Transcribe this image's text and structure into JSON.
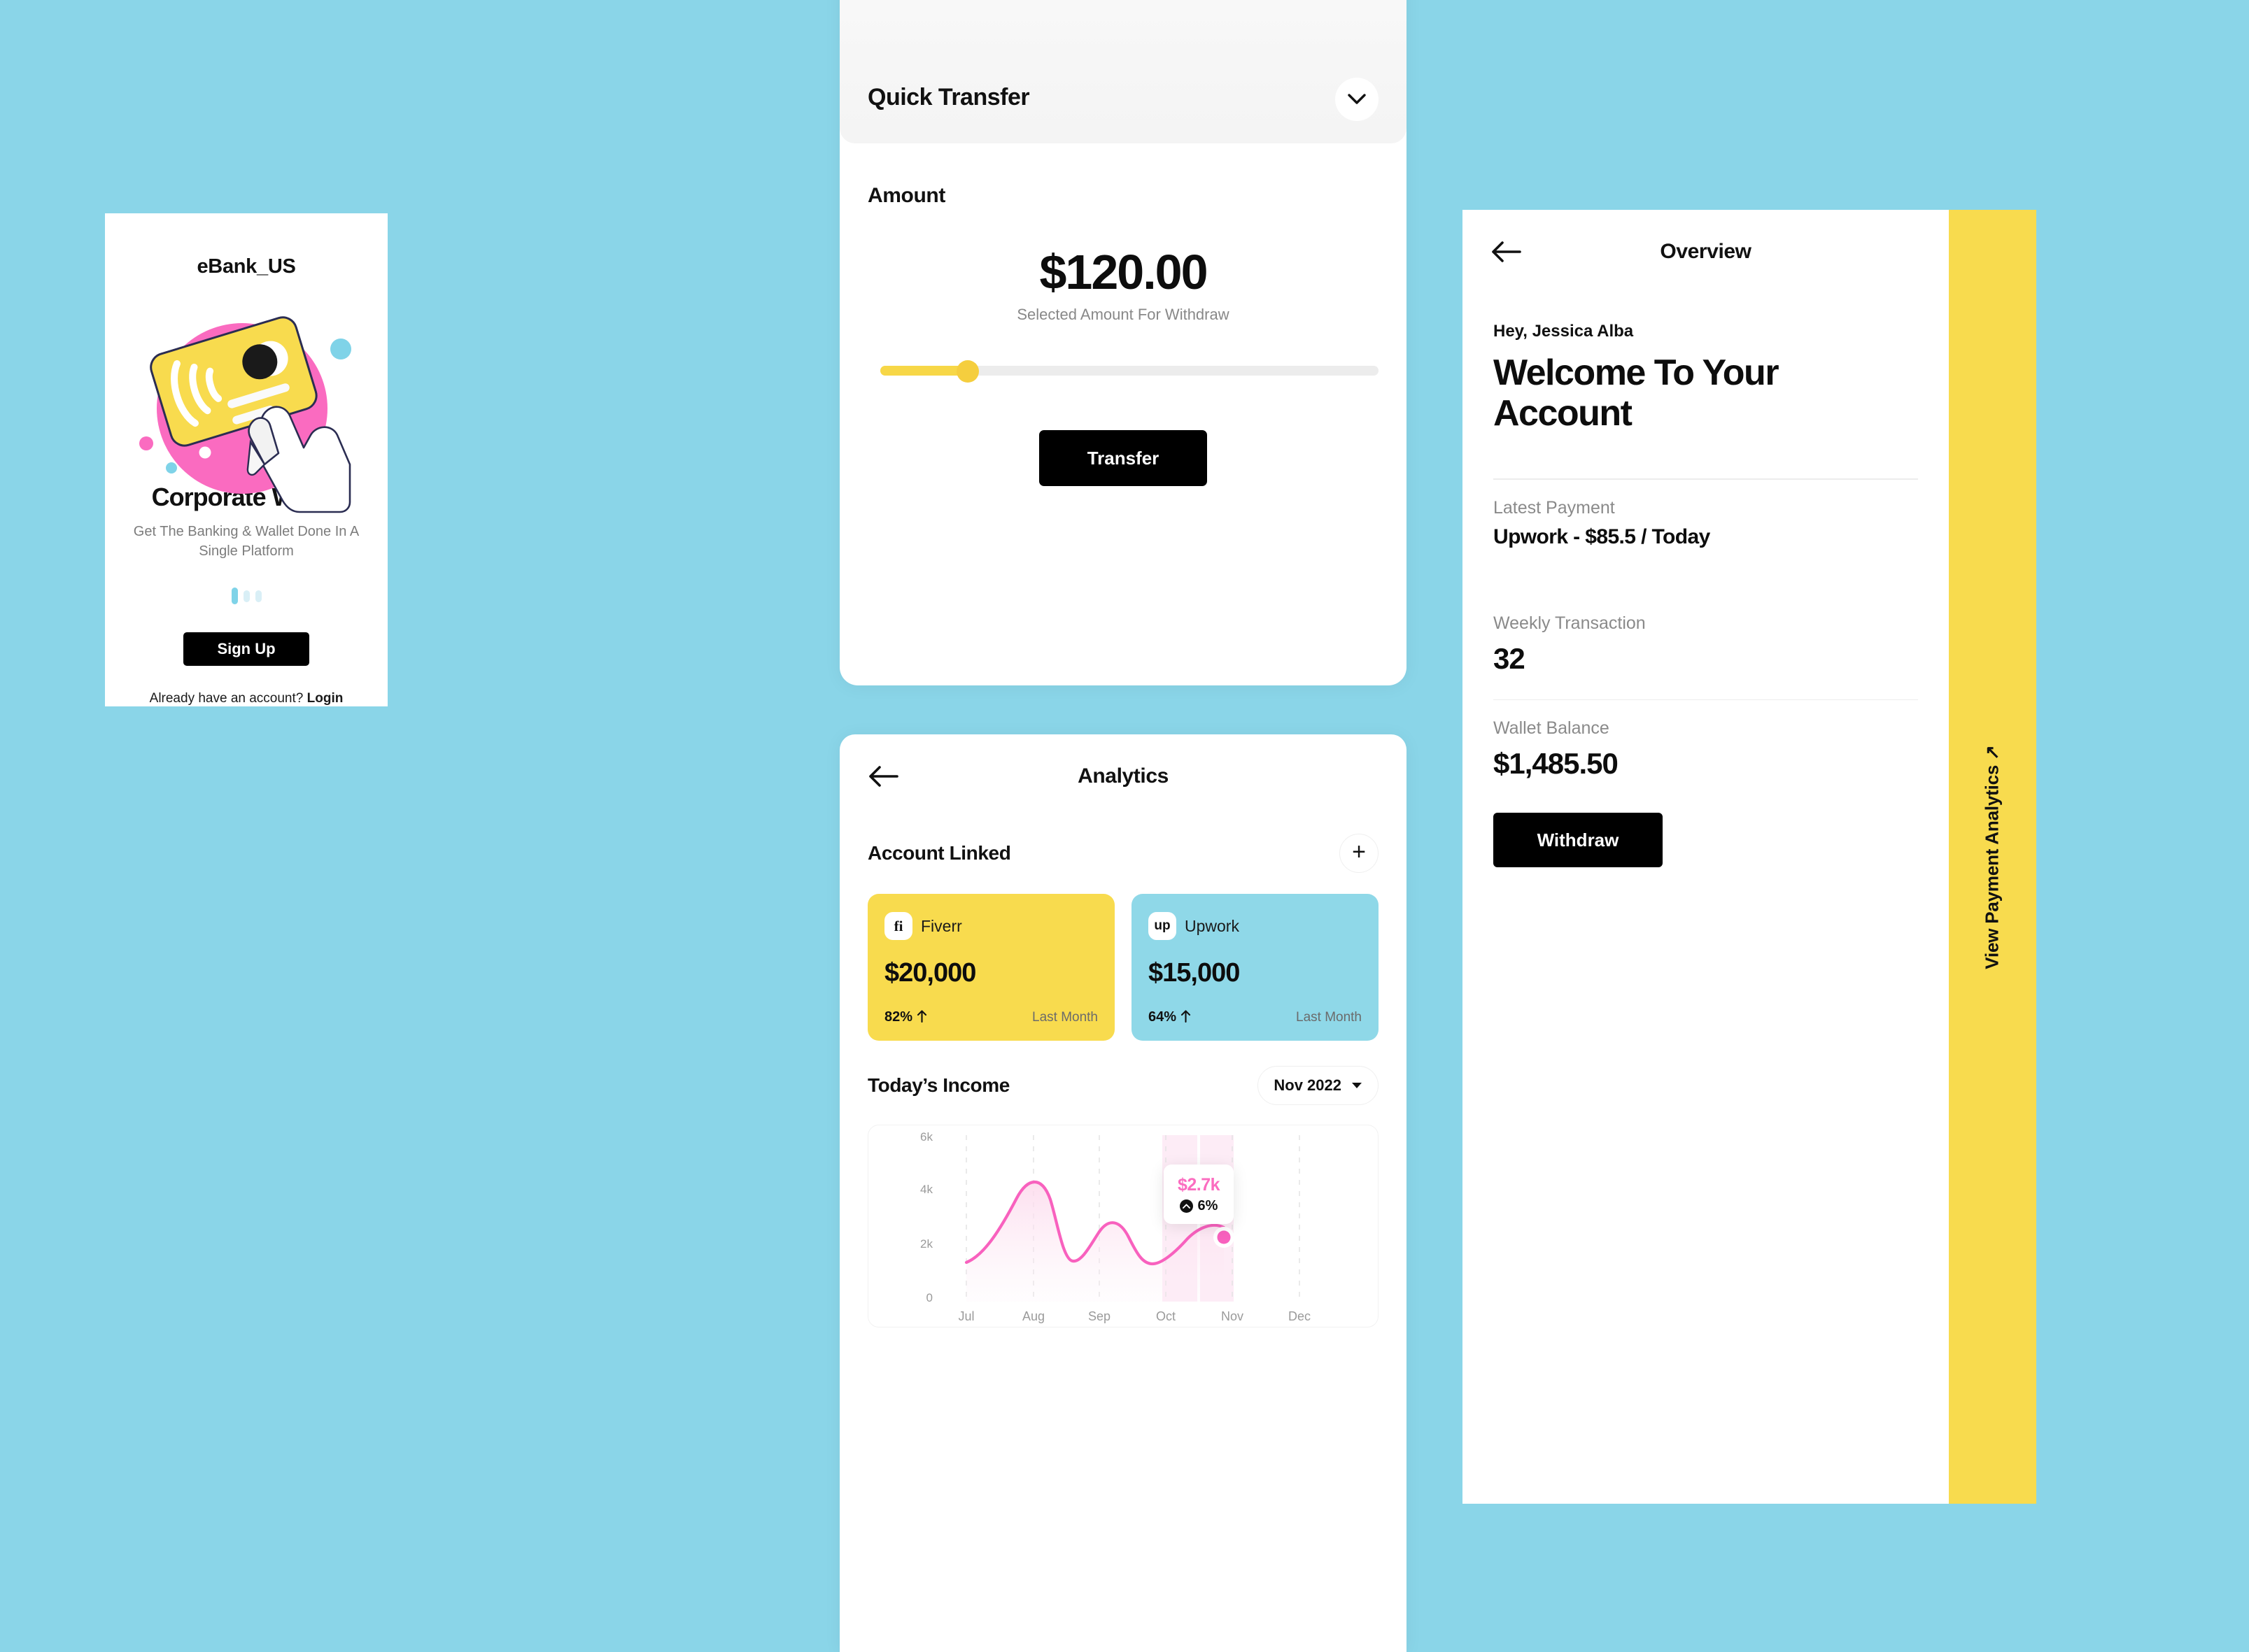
{
  "theme": {
    "background": "#8AD5E8",
    "yellow": "#F8DB4E",
    "blue": "#8FD8E8",
    "pink": "#FB6DC0",
    "black": "#000000"
  },
  "onboarding": {
    "brand": "eBank_US",
    "illustration_name": "contactless-card-in-hand-illustration",
    "title": "Corporate Wallet",
    "subtitle": "Get The Banking & Wallet Done In A Single Platform",
    "pager_total": 3,
    "pager_active": 1,
    "signup_label": "Sign Up",
    "login_prompt": "Already have an account? ",
    "login_label": "Login"
  },
  "quick_transfer": {
    "title": "Quick Transfer",
    "collapse_icon": "chevron-down-icon",
    "amount_label": "Amount",
    "amount_value": "$120.00",
    "amount_caption": "Selected Amount For Withdraw",
    "slider_percent": 19,
    "transfer_label": "Transfer"
  },
  "analytics": {
    "back_icon": "arrow-left-icon",
    "title": "Analytics",
    "account_linked_label": "Account Linked",
    "add_icon": "plus-icon",
    "accounts": [
      {
        "logo": "fiverr-icon",
        "logo_glyph": "fi",
        "name": "Fiverr",
        "amount": "$20,000",
        "delta": "82%",
        "delta_icon": "arrow-up-icon",
        "period": "Last Month",
        "color": "#F8DB4E"
      },
      {
        "logo": "upwork-icon",
        "logo_glyph": "up",
        "name": "Upwork",
        "amount": "$15,000",
        "delta": "64%",
        "delta_icon": "arrow-up-icon",
        "period": "Last Month",
        "color": "#8FD8E8"
      }
    ],
    "income_title": "Today’s Income",
    "month_selected": "Nov 2022",
    "month_caret": "caret-down-icon",
    "tooltip": {
      "value": "$2.7k",
      "change": "6%",
      "change_icon": "chevron-up-icon"
    }
  },
  "chart_data": {
    "type": "area",
    "title": "Today’s Income",
    "xlabel": "",
    "ylabel": "",
    "categories": [
      "Jul",
      "Aug",
      "Sep",
      "Oct",
      "Nov",
      "Dec"
    ],
    "values": [
      1500,
      4300,
      2900,
      1700,
      2700,
      null
    ],
    "ytick_labels": [
      "6k",
      "4k",
      "2k",
      "0"
    ],
    "ytick_values": [
      6000,
      4000,
      2000,
      0
    ],
    "ylim": [
      0,
      6500
    ],
    "grid": true,
    "legend": "none",
    "line_color": "#FB6DC0",
    "fill_color": "#FDE6F3",
    "highlight": {
      "category": "Nov",
      "value": 2700,
      "label": "$2.7k",
      "change": "6%"
    },
    "annotations": [
      "$2.7k",
      "6%"
    ]
  },
  "overview": {
    "back_icon": "arrow-left-icon",
    "title": "Overview",
    "greeting": "Hey, Jessica Alba",
    "welcome_title": "Welcome To Your Account",
    "stats": [
      {
        "label": "Latest Payment",
        "value": "Upwork - $85.5 / Today"
      },
      {
        "label": "Weekly Transaction",
        "value": "32"
      },
      {
        "label": "Wallet Balance",
        "value": "$1,485.50"
      }
    ],
    "withdraw_label": "Withdraw",
    "sidebar_label": "View Payment Analytics ↗"
  }
}
